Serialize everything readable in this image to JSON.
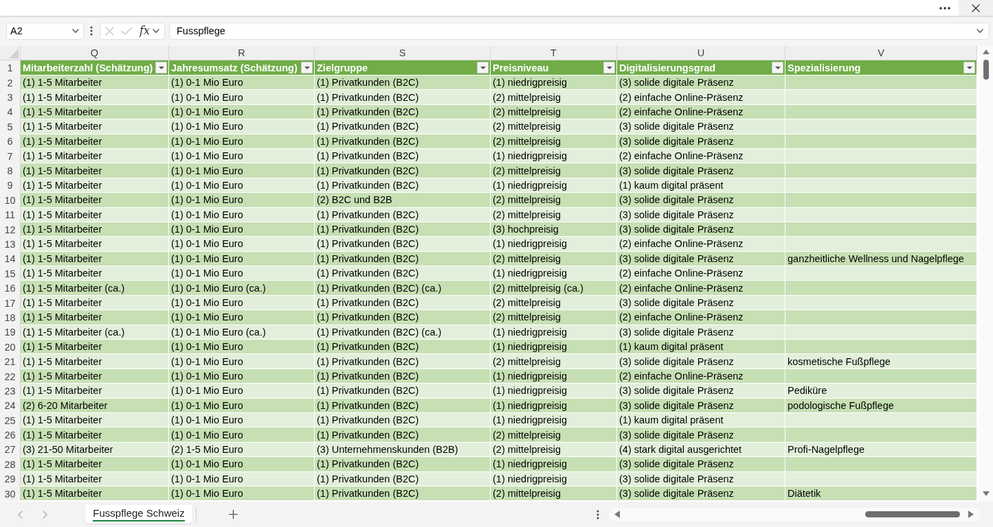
{
  "formula_bar": {
    "name_box": "A2",
    "cancel": {
      "disabled": true
    },
    "enter": {
      "disabled": true
    },
    "insert_function": "fx",
    "formula": "Fusspflege"
  },
  "sheet": {
    "columns": [
      {
        "letter": "Q",
        "title": "Mitarbeiterzahl (Schätzung)"
      },
      {
        "letter": "R",
        "title": "Jahresumsatz (Schätzung)"
      },
      {
        "letter": "S",
        "title": "Zielgruppe"
      },
      {
        "letter": "T",
        "title": "Preisniveau"
      },
      {
        "letter": "U",
        "title": "Digitalisierungsgrad"
      },
      {
        "letter": "V",
        "title": "Spezialisierung"
      }
    ],
    "header_row_number": "1",
    "rows": [
      {
        "number": "2",
        "cells": [
          "(1) 1-5 Mitarbeiter",
          "(1) 0-1 Mio Euro",
          "(1) Privatkunden (B2C)",
          "(1) niedrigpreisig",
          "(3) solide digitale Präsenz"
        ]
      },
      {
        "number": "3",
        "cells": [
          "(1) 1-5 Mitarbeiter",
          "(1) 0-1 Mio Euro",
          "(1) Privatkunden (B2C)",
          "(2) mittelpreisig",
          "(2) einfache Online-Präsenz"
        ]
      },
      {
        "number": "4",
        "cells": [
          "(1) 1-5 Mitarbeiter",
          "(1) 0-1 Mio Euro",
          "(1) Privatkunden (B2C)",
          "(2) mittelpreisig",
          "(2) einfache Online-Präsenz"
        ]
      },
      {
        "number": "5",
        "cells": [
          "(1) 1-5 Mitarbeiter",
          "(1) 0-1 Mio Euro",
          "(1) Privatkunden (B2C)",
          "(2) mittelpreisig",
          "(3) solide digitale Präsenz"
        ]
      },
      {
        "number": "6",
        "cells": [
          "(1) 1-5 Mitarbeiter",
          "(1) 0-1 Mio Euro",
          "(1) Privatkunden (B2C)",
          "(2) mittelpreisig",
          "(3) solide digitale Präsenz"
        ]
      },
      {
        "number": "7",
        "cells": [
          "(1) 1-5 Mitarbeiter",
          "(1) 0-1 Mio Euro",
          "(1) Privatkunden (B2C)",
          "(1) niedrigpreisig",
          "(2) einfache Online-Präsenz"
        ]
      },
      {
        "number": "8",
        "cells": [
          "(1) 1-5 Mitarbeiter",
          "(1) 0-1 Mio Euro",
          "(1) Privatkunden (B2C)",
          "(2) mittelpreisig",
          "(3) solide digitale Präsenz"
        ]
      },
      {
        "number": "9",
        "cells": [
          "(1) 1-5 Mitarbeiter",
          "(1) 0-1 Mio Euro",
          "(1) Privatkunden (B2C)",
          "(1) niedrigpreisig",
          "(1) kaum digital präsent"
        ]
      },
      {
        "number": "10",
        "cells": [
          "(1) 1-5 Mitarbeiter",
          "(1) 0-1 Mio Euro",
          "(2) B2C und B2B",
          "(2) mittelpreisig",
          "(3) solide digitale Präsenz"
        ]
      },
      {
        "number": "11",
        "cells": [
          "(1) 1-5 Mitarbeiter",
          "(1) 0-1 Mio Euro",
          "(1) Privatkunden (B2C)",
          "(2) mittelpreisig",
          "(3) solide digitale Präsenz"
        ]
      },
      {
        "number": "12",
        "cells": [
          "(1) 1-5 Mitarbeiter",
          "(1) 0-1 Mio Euro",
          "(1) Privatkunden (B2C)",
          "(3) hochpreisig",
          "(3) solide digitale Präsenz"
        ]
      },
      {
        "number": "13",
        "cells": [
          "(1) 1-5 Mitarbeiter",
          "(1) 0-1 Mio Euro",
          "(1) Privatkunden (B2C)",
          "(1) niedrigpreisig",
          "(2) einfache Online-Präsenz"
        ]
      },
      {
        "number": "14",
        "cells": [
          "(1) 1-5 Mitarbeiter",
          "(1) 0-1 Mio Euro",
          "(1) Privatkunden (B2C)",
          "(2) mittelpreisig",
          "(3) solide digitale Präsenz",
          "ganzheitliche Wellness und Nagelpflege"
        ]
      },
      {
        "number": "15",
        "cells": [
          "(1) 1-5 Mitarbeiter",
          "(1) 0-1 Mio Euro",
          "(1) Privatkunden (B2C)",
          "(1) niedrigpreisig",
          "(2) einfache Online-Präsenz"
        ]
      },
      {
        "number": "16",
        "cells": [
          "(1) 1-5 Mitarbeiter (ca.)",
          "(1) 0-1 Mio Euro (ca.)",
          "(1) Privatkunden (B2C) (ca.)",
          "(2) mittelpreisig (ca.)",
          "(2) einfache Online-Präsenz"
        ]
      },
      {
        "number": "17",
        "cells": [
          "(1) 1-5 Mitarbeiter",
          "(1) 0-1 Mio Euro",
          "(1) Privatkunden (B2C)",
          "(2) mittelpreisig",
          "(3) solide digitale Präsenz"
        ]
      },
      {
        "number": "18",
        "cells": [
          "(1) 1-5 Mitarbeiter",
          "(1) 0-1 Mio Euro",
          "(1) Privatkunden (B2C)",
          "(2) mittelpreisig",
          "(2) einfache Online-Präsenz"
        ]
      },
      {
        "number": "19",
        "cells": [
          "(1) 1-5 Mitarbeiter (ca.)",
          "(1) 0-1 Mio Euro (ca.)",
          "(1) Privatkunden (B2C) (ca.)",
          "(1) niedrigpreisig",
          "(3) solide digitale Präsenz"
        ]
      },
      {
        "number": "20",
        "cells": [
          "(1) 1-5 Mitarbeiter",
          "(1) 0-1 Mio Euro",
          "(1) Privatkunden (B2C)",
          "(1) niedrigpreisig",
          "(1) kaum digital präsent"
        ]
      },
      {
        "number": "21",
        "cells": [
          "(1) 1-5 Mitarbeiter",
          "(1) 0-1 Mio Euro",
          "(1) Privatkunden (B2C)",
          "(2) mittelpreisig",
          "(3) solide digitale Präsenz",
          "kosmetische Fußpflege"
        ]
      },
      {
        "number": "22",
        "cells": [
          "(1) 1-5 Mitarbeiter",
          "(1) 0-1 Mio Euro",
          "(1) Privatkunden (B2C)",
          "(1) niedrigpreisig",
          "(2) einfache Online-Präsenz"
        ]
      },
      {
        "number": "23",
        "cells": [
          "(1) 1-5 Mitarbeiter",
          "(1) 0-1 Mio Euro",
          "(1) Privatkunden (B2C)",
          "(1) niedrigpreisig",
          "(3) solide digitale Präsenz",
          "Pediküre"
        ]
      },
      {
        "number": "24",
        "cells": [
          "(2) 6-20 Mitarbeiter",
          "(1) 0-1 Mio Euro",
          "(1) Privatkunden (B2C)",
          "(1) niedrigpreisig",
          "(3) solide digitale Präsenz",
          "podologische Fußpflege"
        ]
      },
      {
        "number": "25",
        "cells": [
          "(1) 1-5 Mitarbeiter",
          "(1) 0-1 Mio Euro",
          "(1) Privatkunden (B2C)",
          "(1) niedrigpreisig",
          "(1) kaum digital präsent"
        ]
      },
      {
        "number": "26",
        "cells": [
          "(1) 1-5 Mitarbeiter",
          "(1) 0-1 Mio Euro",
          "(1) Privatkunden (B2C)",
          "(2) mittelpreisig",
          "(3) solide digitale Präsenz"
        ]
      },
      {
        "number": "27",
        "cells": [
          "(3) 21-50 Mitarbeiter",
          "(2) 1-5 Mio Euro",
          "(3) Unternehmenskunden (B2B)",
          "(2) mittelpreisig",
          "(4) stark digital ausgerichtet",
          "Profi-Nagelpflege"
        ]
      },
      {
        "number": "28",
        "cells": [
          "(1) 1-5 Mitarbeiter",
          "(1) 0-1 Mio Euro",
          "(1) Privatkunden (B2C)",
          "(1) niedrigpreisig",
          "(3) solide digitale Präsenz"
        ]
      },
      {
        "number": "29",
        "cells": [
          "(1) 1-5 Mitarbeiter",
          "(1) 0-1 Mio Euro",
          "(1) Privatkunden (B2C)",
          "(1) niedrigpreisig",
          "(3) solide digitale Präsenz"
        ]
      },
      {
        "number": "30",
        "cells": [
          "(1) 1-5 Mitarbeiter",
          "(1) 0-1 Mio Euro",
          "(1) Privatkunden (B2C)",
          "(2) mittelpreisig",
          "(3) solide digitale Präsenz",
          "Diätetik"
        ]
      }
    ]
  },
  "sheet_tabs": [
    {
      "label": "Fusspflege Schweiz",
      "selected": true
    }
  ]
}
